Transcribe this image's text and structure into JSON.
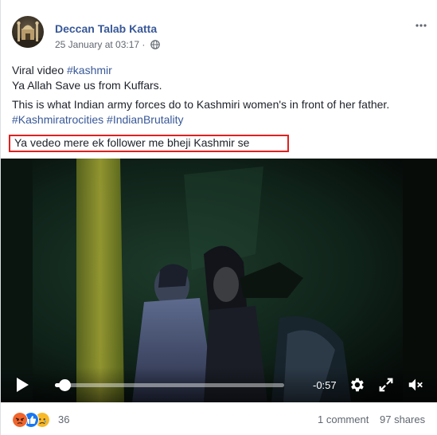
{
  "post": {
    "page_name": "Deccan Talab Katta",
    "timestamp": "25 January at 03:17",
    "lines": [
      {
        "text": "Viral video ",
        "hashtag": "#kashmir"
      },
      {
        "text": "Ya Allah Save us from Kuffars."
      }
    ],
    "paragraph2": "This is what Indian army forces do to Kashmiri women's in front of her father.",
    "hashtags2": "#Kashmiratrocities #IndianBrutality",
    "highlighted_line": "Ya vedeo mere ek follower me bheji Kashmir se"
  },
  "video": {
    "time_remaining": "-0:57",
    "progress_fraction": 0.04
  },
  "footer": {
    "reaction_count": "36",
    "reactions": [
      "angry-icon",
      "like-icon",
      "sad-icon"
    ],
    "comments": "1 comment",
    "shares": "97 shares"
  },
  "colors": {
    "link": "#385898",
    "highlight_border": "#e0211f",
    "angry": "#f0652d",
    "like": "#1877f2",
    "sad": "#f7b928"
  }
}
